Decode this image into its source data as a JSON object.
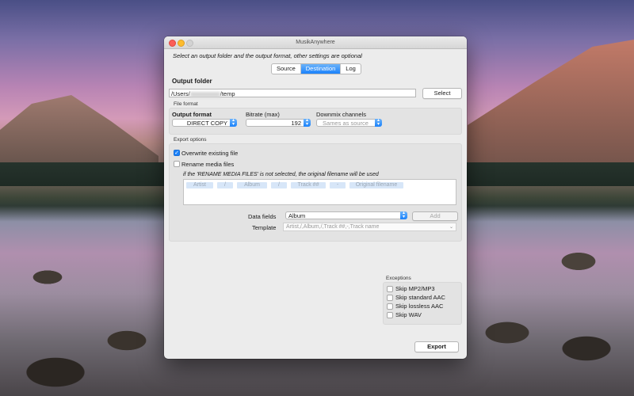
{
  "window": {
    "title": "MusikAnywhere"
  },
  "intro": "Select an output folder and the output format, other settings are optional",
  "tabs": [
    {
      "label": "Source",
      "active": false
    },
    {
      "label": "Destination",
      "active": true
    },
    {
      "label": "Log",
      "active": false
    }
  ],
  "output_folder": {
    "heading": "Output folder",
    "path_prefix": "/Users/",
    "path_suffix": "/temp",
    "select_label": "Select"
  },
  "file_format": {
    "group_label": "File format",
    "output_format_label": "Output format",
    "output_format_value": "DIRECT COPY",
    "bitrate_label": "Bitrate (max)",
    "bitrate_value": "192",
    "downmix_label": "Downmix channels",
    "downmix_value": "Sames as source"
  },
  "export_options": {
    "group_label": "Export options",
    "overwrite_label": "Overwrite existing file",
    "overwrite_checked": true,
    "rename_label": "Rename media files",
    "rename_checked": false,
    "note": "if the 'RENAME MEDIA FILES' is not selected, the original filename will be used",
    "tokens": [
      "Artist",
      "/",
      "Album",
      "/",
      "Track ##",
      "-",
      "Original filename"
    ],
    "data_fields_label": "Data fields",
    "data_fields_value": "Album",
    "add_label": "Add",
    "template_label": "Template",
    "template_value": "Artist,/,Album,/,Track ##,-,Track name"
  },
  "exceptions": {
    "group_label": "Exceptions",
    "items": [
      {
        "label": "Skip MP2/MP3",
        "checked": false
      },
      {
        "label": "Skip standard AAC",
        "checked": false
      },
      {
        "label": "Skip lossless AAC",
        "checked": false
      },
      {
        "label": "Skip WAV",
        "checked": false
      }
    ]
  },
  "export_label": "Export",
  "colors": {
    "accent": "#1a82fb",
    "window_bg": "#ececec",
    "group_bg": "#e3e3e3"
  }
}
